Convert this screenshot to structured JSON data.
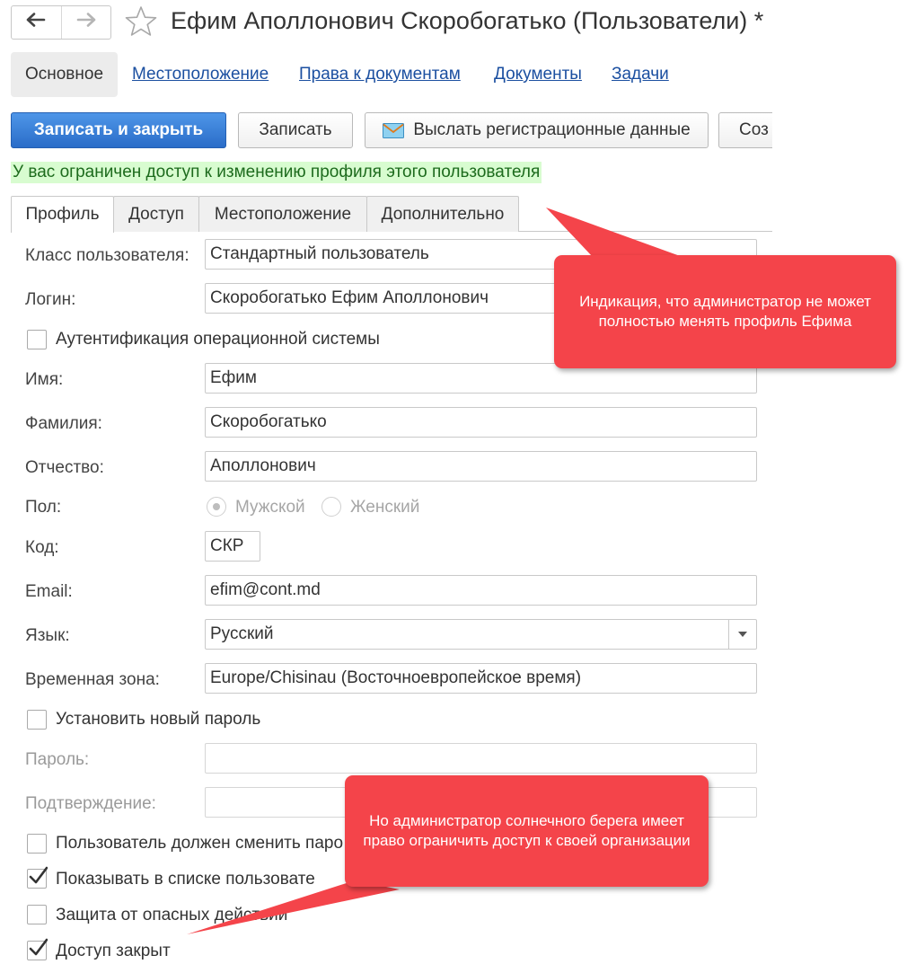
{
  "header": {
    "title": "Ефим Аполлонович Скоробогатько (Пользователи) *",
    "back_icon": "arrow-left-icon",
    "forward_icon": "arrow-right-icon",
    "favorite_icon": "star-icon"
  },
  "top_tabs": {
    "active": "Основное",
    "links": [
      "Местоположение",
      "Права к документам",
      "Документы",
      "Задачи"
    ]
  },
  "toolbar": {
    "save_close": "Записать и закрыть",
    "save": "Записать",
    "send_reg_data": "Выслать регистрационные данные",
    "create_clipped": "Соз",
    "envelope_icon": "envelope-icon"
  },
  "notice": "У вас ограничен доступ к изменению профиля этого пользователя",
  "sub_tabs": [
    "Профиль",
    "Доступ",
    "Местоположение",
    "Дополнительно"
  ],
  "form": {
    "user_class": {
      "label": "Класс пользователя:",
      "value": "Стандартный пользователь"
    },
    "login": {
      "label": "Логин:",
      "value": "Скоробогатько Ефим Аполлонович"
    },
    "os_auth": {
      "label": "Аутентификация операционной системы",
      "checked": false
    },
    "first_name": {
      "label": "Имя:",
      "value": "Ефим"
    },
    "last_name": {
      "label": "Фамилия:",
      "value": "Скоробогатько"
    },
    "patronymic": {
      "label": "Отчество:",
      "value": "Аполлонович"
    },
    "gender": {
      "label": "Пол:",
      "male": "Мужской",
      "female": "Женский",
      "selected": "Мужской"
    },
    "code": {
      "label": "Код:",
      "value": "СКР"
    },
    "email": {
      "label": "Email:",
      "value": "efim@cont.md"
    },
    "language": {
      "label": "Язык:",
      "value": "Русский"
    },
    "timezone": {
      "label": "Временная зона:",
      "value": "Europe/Chisinau (Восточноевропейское время)"
    },
    "set_new_password": {
      "label": "Установить новый пароль",
      "checked": false
    },
    "password": {
      "label": "Пароль:",
      "value": ""
    },
    "confirm": {
      "label": "Подтверждение:",
      "value": ""
    },
    "must_change_password": {
      "label": "Пользователь должен сменить паро",
      "checked": false
    },
    "show_in_list": {
      "label": "Показывать в списке пользовате",
      "checked": true
    },
    "dangerous_protection": {
      "label": "Защита от опасных действий",
      "checked": false
    },
    "access_closed": {
      "label": "Доступ закрыт",
      "checked": true
    }
  },
  "callouts": [
    {
      "text": "Индикация, что администратор не может полностью менять профиль Ефима",
      "color": "#f4444a"
    },
    {
      "text": "Но администратор солнечного берега имеет право ограничить доступ к своей организации",
      "color": "#f4444a"
    }
  ],
  "colors": {
    "accent": "#2a6cc8",
    "link": "#1b4fa0",
    "notice_bg": "#d8fcd0",
    "callout": "#f4444a"
  }
}
